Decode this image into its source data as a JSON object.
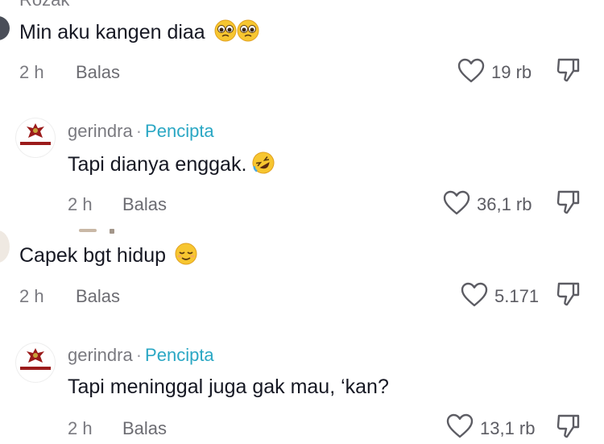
{
  "comments": [
    {
      "username": "Rozak",
      "text": "Min aku kangen diaa",
      "emoji": [
        "pleading-face",
        "pleading-face"
      ],
      "time": "2 h",
      "reply_label": "Balas",
      "likes": "19 rb"
    },
    {
      "username": "gerindra",
      "badge": "Pencipta",
      "separator": "·",
      "text": "Tapi dianya enggak.",
      "emoji": [
        "rolling-laughing-face"
      ],
      "time": "2 h",
      "reply_label": "Balas",
      "likes": "36,1 rb"
    },
    {
      "text": "Capek bgt hidup",
      "emoji": [
        "relieved-face"
      ],
      "time": "2 h",
      "reply_label": "Balas",
      "likes": "5.171"
    },
    {
      "username": "gerindra",
      "badge": "Pencipta",
      "separator": "·",
      "text": "Tapi meninggal juga gak mau, ‘kan?",
      "emoji": [],
      "time": "2 h",
      "reply_label": "Balas",
      "likes": "13,1 rb"
    }
  ],
  "icons": {
    "like": "heart-outline-icon",
    "dislike": "thumbs-down-icon"
  },
  "colors": {
    "creator_badge": "#2aa7c4",
    "meta_text": "#7a7a80",
    "gerindra_red": "#9b1b1b",
    "gerindra_gold": "#c8a23a"
  }
}
